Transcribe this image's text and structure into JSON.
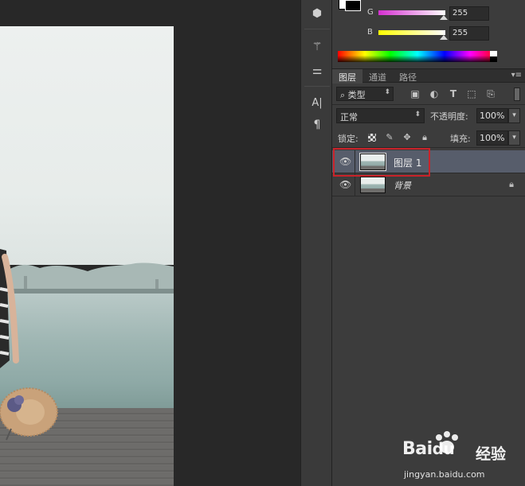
{
  "app": {
    "accent_selected_row": "#575d6b",
    "highlight_color": "#c9232a"
  },
  "color_panel": {
    "sliders": [
      {
        "label": "G",
        "value": "255",
        "gradient": "linear-gradient(to right, #d52fd1, #ffffff)"
      },
      {
        "label": "B",
        "value": "255",
        "gradient": "linear-gradient(to right, #ffff00, #ffffff)"
      }
    ]
  },
  "tools": [
    {
      "name": "3d-cube-icon",
      "glyph": "⬢"
    },
    {
      "name": "brush-presets-icon",
      "glyph": "⚚"
    },
    {
      "name": "adjustments-icon",
      "glyph": "⚌"
    },
    {
      "name": "character-icon",
      "glyph": "A|"
    },
    {
      "name": "paragraph-icon",
      "glyph": "¶"
    }
  ],
  "layers_panel": {
    "tabs": [
      {
        "label": "图层",
        "active": true
      },
      {
        "label": "通道",
        "active": false
      },
      {
        "label": "路径",
        "active": false
      }
    ],
    "filter": {
      "kind_label": "类型",
      "search_glyph": "⌕"
    },
    "filter_icons": [
      "image-filter-icon",
      "adjustment-filter-icon",
      "type-filter-icon",
      "shape-filter-icon",
      "smart-object-filter-icon"
    ],
    "blend_mode": "正常",
    "opacity_label": "不透明度:",
    "opacity_value": "100%",
    "lock_label": "锁定:",
    "fill_label": "填充:",
    "fill_value": "100%",
    "layers": [
      {
        "name": "图层 1",
        "selected": true,
        "italic": false,
        "locked": false
      },
      {
        "name": "背景",
        "selected": false,
        "italic": true,
        "locked": true
      }
    ]
  },
  "watermark": {
    "brand_a": "Bai",
    "brand_b": "du",
    "brand_c": "经验",
    "url": "jingyan.baidu.com"
  }
}
